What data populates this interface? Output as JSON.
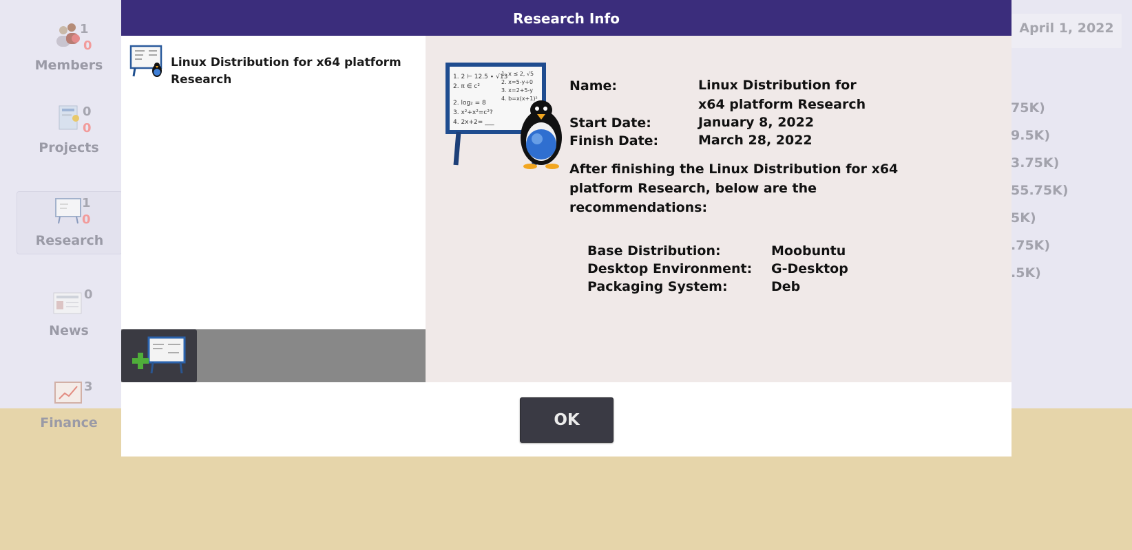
{
  "background": {
    "date": "April 1, 2022",
    "sidebar": [
      {
        "label": "Members",
        "count_a": "1",
        "count_b": "0"
      },
      {
        "label": "Projects",
        "count_a": "0",
        "count_b": "0"
      },
      {
        "label": "Research",
        "count_a": "1",
        "count_b": "0"
      },
      {
        "label": "News",
        "count_a": "0",
        "count_b": ""
      },
      {
        "label": "Finance",
        "count_a": "3",
        "count_b": ""
      }
    ],
    "right_list": [
      "75K)",
      "9.5K)",
      "3.75K)",
      "55.75K)",
      "5K)",
      ".75K)",
      ".5K)"
    ]
  },
  "dialog": {
    "title": "Research Info",
    "list": [
      {
        "name": "Linux Distribution for x64 platform Research"
      }
    ],
    "add_button_icon": "add-research-icon",
    "details": {
      "name_label": "Name:",
      "name_value": "Linux Distribution for x64 platform Research",
      "start_label": "Start Date:",
      "start_value": "January 8, 2022",
      "finish_label": "Finish Date:",
      "finish_value": "March 28, 2022",
      "summary": "After finishing the Linux Distribution for x64 platform Research, below are the recommendations:",
      "recommendations": [
        {
          "label": "Base Distribution:",
          "value": "Moobuntu"
        },
        {
          "label": "Desktop Environment:",
          "value": "G-Desktop"
        },
        {
          "label": "Packaging System:",
          "value": "Deb"
        }
      ]
    },
    "ok_label": "OK"
  }
}
